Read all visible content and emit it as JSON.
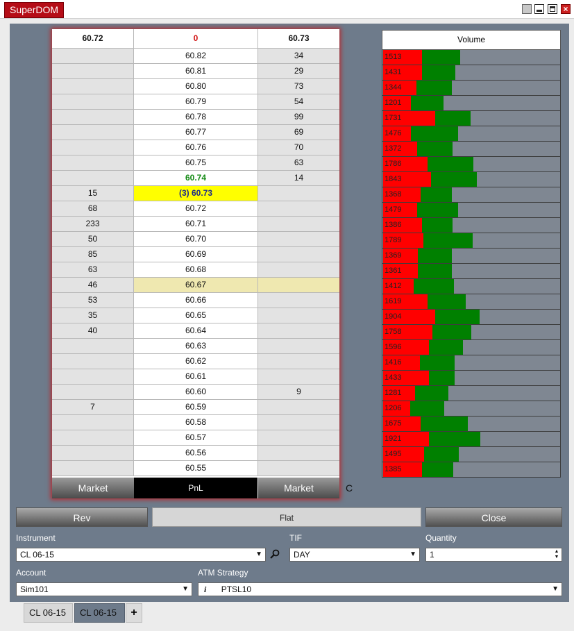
{
  "window": {
    "title": "SuperDOM"
  },
  "ladder": {
    "header": {
      "bid": "60.72",
      "pnl": "0",
      "ask": "60.73"
    },
    "rows": [
      {
        "bid": "",
        "price": "60.82",
        "ask": "34",
        "type": "normal"
      },
      {
        "bid": "",
        "price": "60.81",
        "ask": "29",
        "type": "normal"
      },
      {
        "bid": "",
        "price": "60.80",
        "ask": "73",
        "type": "normal"
      },
      {
        "bid": "",
        "price": "60.79",
        "ask": "54",
        "type": "normal"
      },
      {
        "bid": "",
        "price": "60.78",
        "ask": "99",
        "type": "normal"
      },
      {
        "bid": "",
        "price": "60.77",
        "ask": "69",
        "type": "normal"
      },
      {
        "bid": "",
        "price": "60.76",
        "ask": "70",
        "type": "normal"
      },
      {
        "bid": "",
        "price": "60.75",
        "ask": "63",
        "type": "normal"
      },
      {
        "bid": "",
        "price": "60.74",
        "ask": "14",
        "type": "last"
      },
      {
        "bid": "15",
        "price": "(3) 60.73",
        "ask": "",
        "type": "position"
      },
      {
        "bid": "68",
        "price": "60.72",
        "ask": "",
        "type": "normal"
      },
      {
        "bid": "233",
        "price": "60.71",
        "ask": "",
        "type": "normal"
      },
      {
        "bid": "50",
        "price": "60.70",
        "ask": "",
        "type": "normal"
      },
      {
        "bid": "85",
        "price": "60.69",
        "ask": "",
        "type": "normal"
      },
      {
        "bid": "63",
        "price": "60.68",
        "ask": "",
        "type": "normal"
      },
      {
        "bid": "46",
        "price": "60.67",
        "ask": "",
        "type": "highlight"
      },
      {
        "bid": "53",
        "price": "60.66",
        "ask": "",
        "type": "normal"
      },
      {
        "bid": "35",
        "price": "60.65",
        "ask": "",
        "type": "normal"
      },
      {
        "bid": "40",
        "price": "60.64",
        "ask": "",
        "type": "normal"
      },
      {
        "bid": "",
        "price": "60.63",
        "ask": "",
        "type": "normal"
      },
      {
        "bid": "",
        "price": "60.62",
        "ask": "",
        "type": "normal"
      },
      {
        "bid": "",
        "price": "60.61",
        "ask": "",
        "type": "normal"
      },
      {
        "bid": "",
        "price": "60.60",
        "ask": "9",
        "type": "normal"
      },
      {
        "bid": "7",
        "price": "60.59",
        "ask": "",
        "type": "normal"
      },
      {
        "bid": "",
        "price": "60.58",
        "ask": "",
        "type": "normal"
      },
      {
        "bid": "",
        "price": "60.57",
        "ask": "",
        "type": "normal"
      },
      {
        "bid": "",
        "price": "60.56",
        "ask": "",
        "type": "normal"
      },
      {
        "bid": "",
        "price": "60.55",
        "ask": "",
        "type": "normal"
      }
    ],
    "footer": {
      "buy_market": "Market",
      "pnl": "PnL",
      "sell_market": "Market"
    },
    "c_label": "C"
  },
  "volume": {
    "header": "Volume",
    "colors": {
      "sell": "#ff0000",
      "buy": "#008000",
      "background": "#7f8792"
    },
    "scale_max": 2700,
    "rows": [
      {
        "total": "1513",
        "sell": 600,
        "buy": 585
      },
      {
        "total": "1431",
        "sell": 600,
        "buy": 515
      },
      {
        "total": "1344",
        "sell": 510,
        "buy": 540
      },
      {
        "total": "1201",
        "sell": 430,
        "buy": 495
      },
      {
        "total": "1731",
        "sell": 795,
        "buy": 545
      },
      {
        "total": "1476",
        "sell": 420,
        "buy": 725
      },
      {
        "total": "1372",
        "sell": 520,
        "buy": 540
      },
      {
        "total": "1786",
        "sell": 680,
        "buy": 705
      },
      {
        "total": "1843",
        "sell": 730,
        "buy": 700
      },
      {
        "total": "1368",
        "sell": 570,
        "buy": 480
      },
      {
        "total": "1479",
        "sell": 520,
        "buy": 630
      },
      {
        "total": "1386",
        "sell": 600,
        "buy": 470
      },
      {
        "total": "1789",
        "sell": 620,
        "buy": 760
      },
      {
        "total": "1369",
        "sell": 530,
        "buy": 520
      },
      {
        "total": "1361",
        "sell": 530,
        "buy": 520
      },
      {
        "total": "1412",
        "sell": 465,
        "buy": 620
      },
      {
        "total": "1619",
        "sell": 675,
        "buy": 580
      },
      {
        "total": "1904",
        "sell": 800,
        "buy": 675
      },
      {
        "total": "1758",
        "sell": 755,
        "buy": 600
      },
      {
        "total": "1596",
        "sell": 705,
        "buy": 525
      },
      {
        "total": "1416",
        "sell": 560,
        "buy": 530
      },
      {
        "total": "1433",
        "sell": 700,
        "buy": 395
      },
      {
        "total": "1281",
        "sell": 490,
        "buy": 510
      },
      {
        "total": "1206",
        "sell": 415,
        "buy": 520
      },
      {
        "total": "1675",
        "sell": 570,
        "buy": 725
      },
      {
        "total": "1921",
        "sell": 700,
        "buy": 790
      },
      {
        "total": "1495",
        "sell": 625,
        "buy": 535
      },
      {
        "total": "1385",
        "sell": 590,
        "buy": 480
      }
    ]
  },
  "actions": {
    "rev": "Rev",
    "flat": "Flat",
    "close": "Close"
  },
  "order": {
    "instrument_label": "Instrument",
    "instrument_value": "CL 06-15",
    "tif_label": "TIF",
    "tif_value": "DAY",
    "quantity_label": "Quantity",
    "quantity_value": "1",
    "account_label": "Account",
    "account_value": "Sim101",
    "atm_label": "ATM Strategy",
    "atm_info": "i",
    "atm_value": "PTSL10"
  },
  "tabs": {
    "tab1": "CL 06-15",
    "tab2": "CL 06-15",
    "add": "+"
  }
}
